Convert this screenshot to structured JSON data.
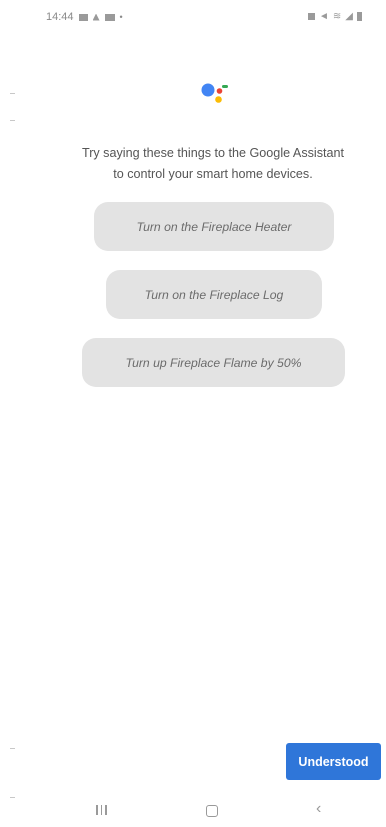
{
  "status_bar": {
    "time": "14:44"
  },
  "assistant": {
    "logo_icon": "google-assistant-icon",
    "colors": {
      "blue": "#4285f4",
      "red": "#ea4335",
      "yellow": "#fbbc05",
      "green": "#34a853"
    }
  },
  "intro": {
    "line1": "Try saying these things to the Google Assistant",
    "line2": "to control your smart home devices."
  },
  "suggestions": [
    {
      "label": "Turn on the Fireplace Heater"
    },
    {
      "label": "Turn on the Fireplace Log"
    },
    {
      "label": "Turn up Fireplace Flame by 50%"
    }
  ],
  "actions": {
    "understood_label": "Understood",
    "accent_color": "#2f76d9"
  },
  "nav": {
    "recents_icon": "recents-icon",
    "home_icon": "home-icon",
    "back_icon": "back-icon"
  }
}
